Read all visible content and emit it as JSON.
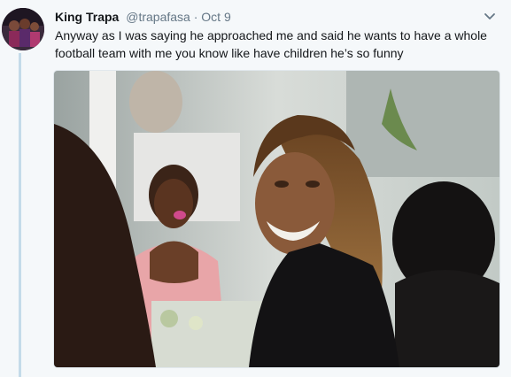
{
  "tweet": {
    "author_name": "King Trapa",
    "handle": "@trapafasa",
    "separator": "·",
    "timestamp": "Oct 9",
    "text": "Anyway as I was saying he approached me and said he wants to have a whole football team with me you know like have children he’s so funny"
  },
  "icons": {
    "caret": "chevron-down-icon",
    "avatar": "profile-avatar"
  },
  "colors": {
    "background": "#f5f8fa",
    "thread_line": "#c4dbe9",
    "text": "#14171a",
    "secondary_text": "#657786"
  }
}
